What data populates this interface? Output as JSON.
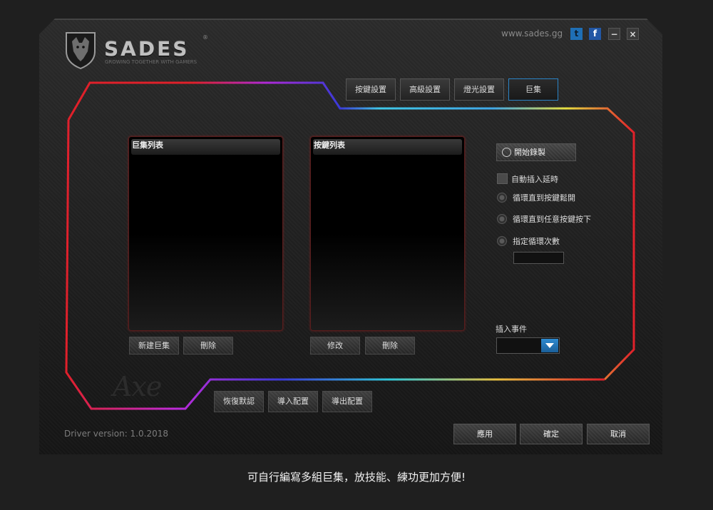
{
  "header": {
    "brand": "SADES",
    "registered": "®",
    "tagline": "GROWING TOGETHER WITH GAMERS",
    "website": "www.sades.gg",
    "twitter_glyph": "t",
    "facebook_glyph": "f",
    "minimize_glyph": "−",
    "close_glyph": "×"
  },
  "tabs": [
    {
      "label": "按鍵設置"
    },
    {
      "label": "高級設置"
    },
    {
      "label": "燈光設置"
    },
    {
      "label": "巨集",
      "active": true
    }
  ],
  "macro_list": {
    "title": "巨集列表",
    "new_button": "新建巨集",
    "delete_button": "刪除"
  },
  "key_list": {
    "title": "按鍵列表",
    "edit_button": "修改",
    "delete_button": "刪除"
  },
  "options": {
    "record_button": "開始錄製",
    "auto_delay": "自動插入延時",
    "loop_until_release": "循環直到按鍵鬆開",
    "loop_until_any_key": "循環直到任意按鍵按下",
    "loop_count": "指定循環次數",
    "loop_count_value": "",
    "insert_event_label": "插入事件",
    "insert_event_value": ""
  },
  "watermark": "Axe",
  "config_buttons": {
    "restore_default": "恢復默認",
    "import": "導入配置",
    "export": "導出配置"
  },
  "footer": {
    "version": "Driver version:  1.0.2018",
    "apply": "應用",
    "ok": "確定",
    "cancel": "取消"
  },
  "caption": "可自行編寫多組巨集，放技能、練功更加方便!",
  "colors": {
    "accent_blue": "#2a84c7",
    "rgb_red": "#e0202a",
    "rgb_purple": "#a030e0",
    "rgb_cyan": "#40c8e8"
  }
}
